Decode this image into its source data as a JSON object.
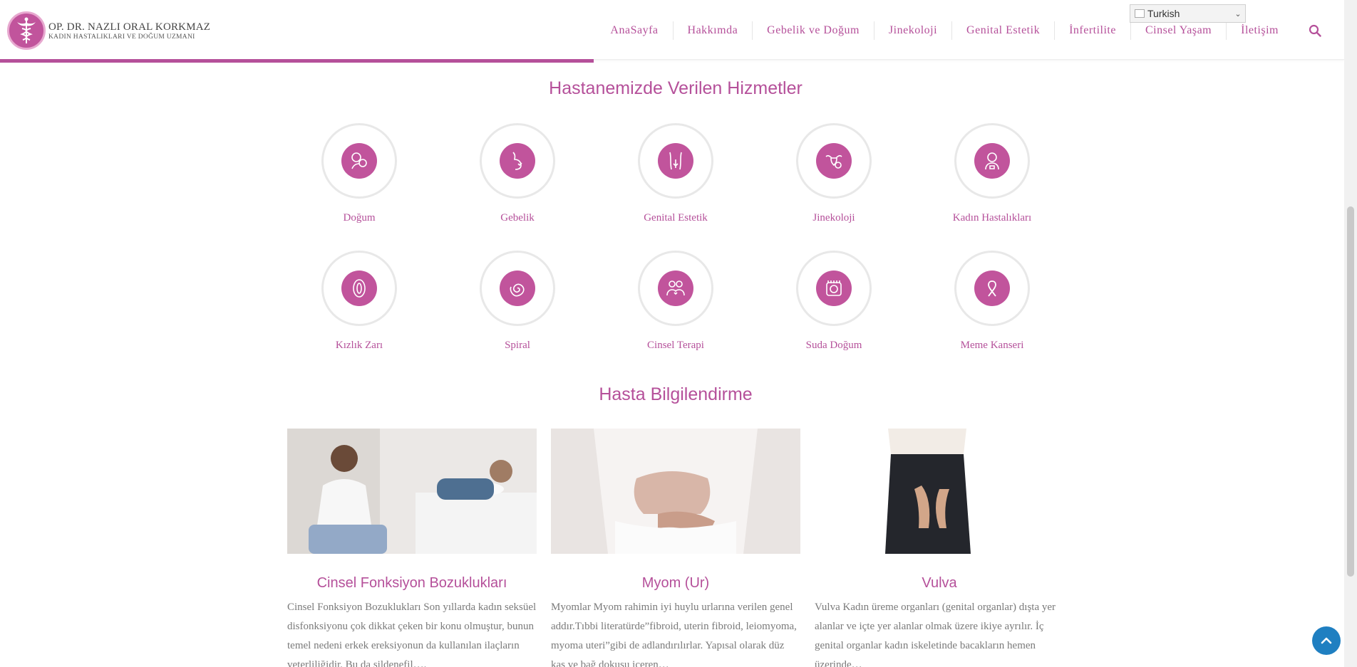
{
  "header": {
    "logo": {
      "name": "OP. DR. NAZLI ORAL KORKMAZ",
      "subtitle": "KADIN HASTALIKLARI VE DOĞUM UZMANI"
    },
    "nav": [
      "AnaSayfa",
      "Hakkımda",
      "Gebelik ve Doğum",
      "Jinekoloji",
      "Genital Estetik",
      "İnfertilite",
      "Cinsel Yaşam",
      "İletişim"
    ],
    "language": {
      "flag_alt": "tr",
      "selected": "Turkish"
    },
    "reading_progress": 0.47
  },
  "services": {
    "title": "Hastanemizde Verilen Hizmetler",
    "items": [
      {
        "label": "Doğum",
        "icon": "mother-baby-icon"
      },
      {
        "label": "Gebelik",
        "icon": "pregnancy-icon"
      },
      {
        "label": "Genital Estetik",
        "icon": "body-icon"
      },
      {
        "label": "Jinekoloji",
        "icon": "uterus-icon"
      },
      {
        "label": "Kadın Hastalıkları",
        "icon": "woman-doctor-icon"
      },
      {
        "label": "Kızlık Zarı",
        "icon": "hymen-icon"
      },
      {
        "label": "Spiral",
        "icon": "spiral-icon"
      },
      {
        "label": "Cinsel Terapi",
        "icon": "couple-icon"
      },
      {
        "label": "Suda Doğum",
        "icon": "water-birth-icon"
      },
      {
        "label": "Meme Kanseri",
        "icon": "ribbon-icon"
      }
    ]
  },
  "articles": {
    "title": "Hasta Bilgilendirme",
    "items": [
      {
        "title": "Cinsel Fonksiyon Bozuklukları",
        "excerpt": "Cinsel Fonksiyon Bozuklukları Son yıllarda kadın seksüel disfonksiyonu çok dikkat çeken bir konu olmuştur, bunun temel nedeni erkek ereksiyonun da kullanılan ilaçların veterliliğidir. Bu da sildenefil…."
      },
      {
        "title": "Myom (Ur)",
        "excerpt": "Myomlar Myom rahimin iyi huylu urlarına verilen genel addır.Tıbbi literatürde”fibroid, uterin fibroid, leiomyoma, myoma uteri”gibi de adlandırılırlar. Yapısal olarak düz kas ve bağ dokusu iceren…"
      },
      {
        "title": "Vulva",
        "excerpt": "Vulva Kadın üreme organları (genital organlar) dışta yer alanlar ve içte yer alanlar olmak üzere ikiye ayrılır. İç genital organlar kadın iskeletinde bacakların hemen üzerinde…"
      }
    ]
  },
  "colors": {
    "accent": "#b5509a",
    "icon_fill": "#c1549c",
    "to_top": "#1f7fc1"
  }
}
